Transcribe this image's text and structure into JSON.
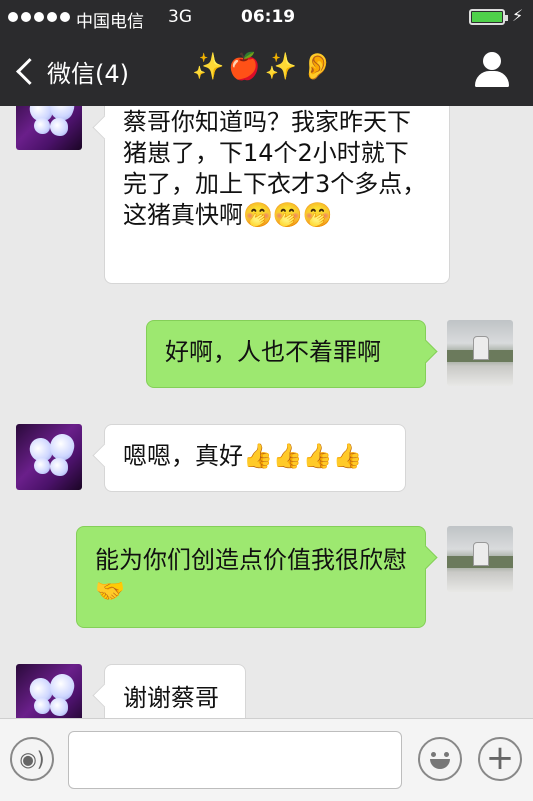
{
  "status_bar": {
    "carrier": "中国电信",
    "network": "3G",
    "time": "06:19",
    "battery_level": 1.0,
    "colors": {
      "battery": "#4fd04a",
      "bar_bg": "#2b2b2d"
    }
  },
  "nav": {
    "back_label": "微信(4)",
    "title": "✨🍎✨👂"
  },
  "messages": [
    {
      "side": "in",
      "text": "蔡哥你知道吗？我家昨天下猪崽了，下14个2小时就下完了，加上下衣才3个多点，这猪真快啊🤭🤭🤭"
    },
    {
      "side": "out",
      "text": "好啊，人也不着罪啊"
    },
    {
      "side": "in",
      "text": "嗯嗯，真好👍👍👍👍"
    },
    {
      "side": "out",
      "text": "能为你们创造点价值我很欣慰🤝"
    },
    {
      "side": "in",
      "text": "谢谢蔡哥"
    }
  ],
  "input_bar": {
    "placeholder": "",
    "icons": [
      "voice-icon",
      "emoji-icon",
      "plus-icon"
    ]
  },
  "colors": {
    "bubble_out": "#9de870",
    "bubble_in": "#ffffff",
    "chat_bg": "#e9e9e9"
  }
}
